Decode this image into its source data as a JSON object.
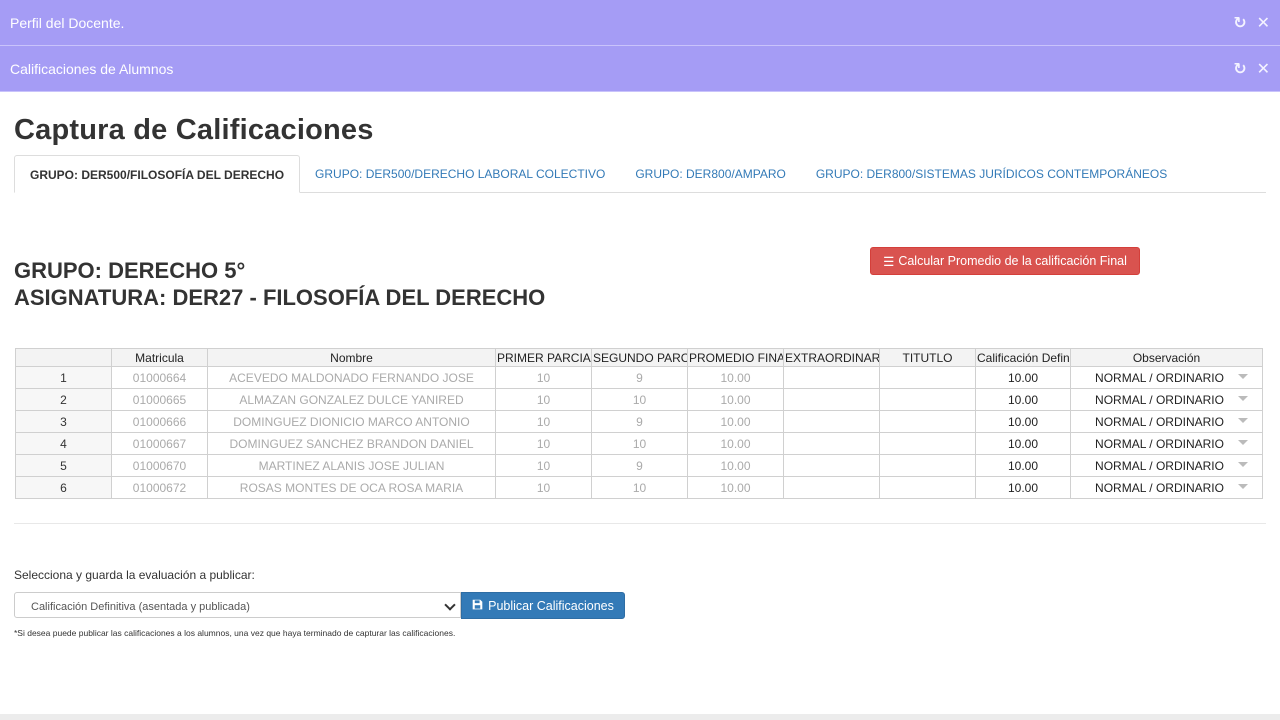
{
  "panels": [
    {
      "title": "Perfil del Docente."
    },
    {
      "title": "Calificaciones de Alumnos"
    }
  ],
  "page_title": "Captura de Calificaciones",
  "tabs": [
    {
      "label": "GRUPO: DER500/FILOSOFÍA DEL DERECHO",
      "active": true
    },
    {
      "label": "GRUPO: DER500/DERECHO LABORAL COLECTIVO",
      "active": false
    },
    {
      "label": "GRUPO: DER800/AMPARO",
      "active": false
    },
    {
      "label": "GRUPO: DER800/SISTEMAS JURÍDICOS CONTEMPORÁNEOS",
      "active": false
    }
  ],
  "group": {
    "grupo": "GRUPO: DERECHO 5°",
    "asignatura": "ASIGNATURA: DER27 - FILOSOFÍA DEL DERECHO"
  },
  "calc_button_label": "Calcular Promedio de la calificación Final",
  "table": {
    "headers": [
      "",
      "Matricula",
      "Nombre",
      "PRIMER PARCIAL",
      "SEGUNDO PARCI.",
      "PROMEDIO FINA",
      "EXTRAORDINARIO",
      "TITUTLO",
      "Calificación Defin",
      "Observación"
    ],
    "rows": [
      [
        "1",
        "01000664",
        "ACEVEDO MALDONADO FERNANDO JOSE",
        "10",
        "9",
        "10.00",
        "",
        "",
        "10.00",
        "NORMAL / ORDINARIO"
      ],
      [
        "2",
        "01000665",
        "ALMAZAN GONZALEZ DULCE YANIRED",
        "10",
        "10",
        "10.00",
        "",
        "",
        "10.00",
        "NORMAL / ORDINARIO"
      ],
      [
        "3",
        "01000666",
        "DOMINGUEZ DIONICIO MARCO ANTONIO",
        "10",
        "9",
        "10.00",
        "",
        "",
        "10.00",
        "NORMAL / ORDINARIO"
      ],
      [
        "4",
        "01000667",
        "DOMINGUEZ SANCHEZ BRANDON DANIEL",
        "10",
        "10",
        "10.00",
        "",
        "",
        "10.00",
        "NORMAL / ORDINARIO"
      ],
      [
        "5",
        "01000670",
        "MARTINEZ ALANIS JOSE JULIAN",
        "10",
        "9",
        "10.00",
        "",
        "",
        "10.00",
        "NORMAL / ORDINARIO"
      ],
      [
        "6",
        "01000672",
        "ROSAS MONTES DE OCA ROSA MARIA",
        "10",
        "10",
        "10.00",
        "",
        "",
        "10.00",
        "NORMAL / ORDINARIO"
      ]
    ]
  },
  "publish": {
    "label": "Selecciona y guarda la evaluación a publicar:",
    "selected": "Calificación Definitiva (asentada y publicada)",
    "button_label": "Publicar Calificaciones",
    "note": "*Si desea puede publicar las calificaciones a los alumnos, una vez que haya terminado de capturar las calificaciones."
  },
  "colors": {
    "panel_header": "#a59cf5",
    "danger": "#d9534f",
    "primary": "#337ab7",
    "link": "#337ab7"
  },
  "icons": {
    "refresh": "↻",
    "close": "✕",
    "list": "☰",
    "save": "💾"
  }
}
